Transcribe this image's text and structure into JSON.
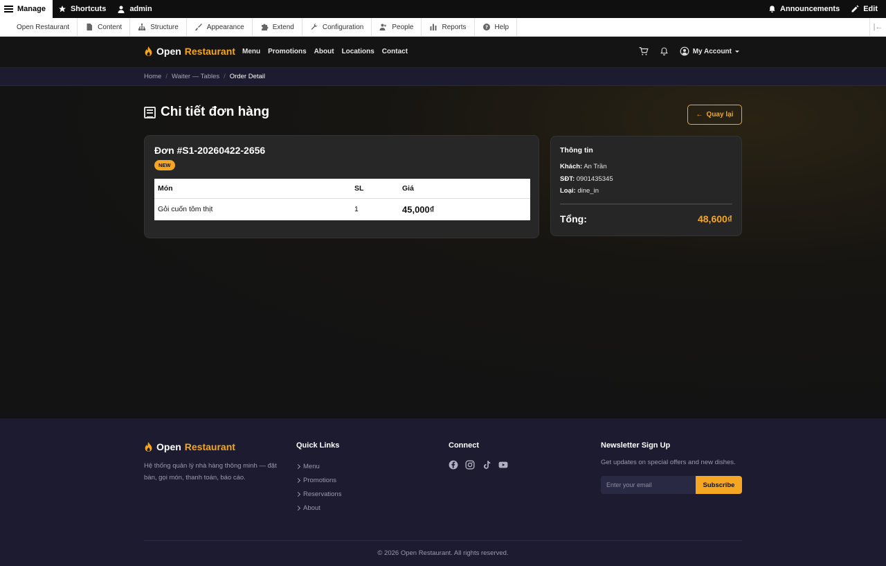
{
  "admin_toolbar": {
    "manage": "Manage",
    "shortcuts": "Shortcuts",
    "user": "admin",
    "announcements": "Announcements",
    "edit": "Edit"
  },
  "admin_tray": {
    "items": [
      "Open Restaurant",
      "Content",
      "Structure",
      "Appearance",
      "Extend",
      "Configuration",
      "People",
      "Reports",
      "Help"
    ]
  },
  "site_header": {
    "brand_first": "Open",
    "brand_second": "Restaurant",
    "nav": [
      "Menu",
      "Promotions",
      "About",
      "Locations",
      "Contact"
    ],
    "account": "My Account"
  },
  "breadcrumb": [
    "Home",
    "Waiter — Tables",
    "Order Detail"
  ],
  "page": {
    "title": "Chi tiết đơn hàng",
    "back_button": "Quay lại"
  },
  "order": {
    "title": "Đơn #S1-20260422-2656",
    "status": "NEW",
    "columns": [
      "Món",
      "SL",
      "Giá"
    ],
    "items": [
      {
        "name": "Gỏi cuốn tôm thịt",
        "qty": "1",
        "price": "45,000₫"
      }
    ]
  },
  "info": {
    "title": "Thông tin",
    "customer_label": "Khách:",
    "customer": "An Trần",
    "phone_label": "SĐT:",
    "phone": "0901435345",
    "type_label": "Loại:",
    "type": "dine_in",
    "total_label": "Tổng:",
    "total": "48,600₫"
  },
  "footer": {
    "brand_first": "Open",
    "brand_second": "Restaurant",
    "description": "Hệ thống quản lý nhà hàng thông minh — đặt bàn, gọi món, thanh toán, báo cáo.",
    "quick_links_title": "Quick Links",
    "quick_links": [
      "Menu",
      "Promotions",
      "Reservations",
      "About"
    ],
    "connect_title": "Connect",
    "newsletter_title": "Newsletter Sign Up",
    "newsletter_desc": "Get updates on special offers and new dishes.",
    "email_placeholder": "Enter your email",
    "subscribe": "Subscribe",
    "copyright": "© 2026 Open Restaurant. All rights reserved."
  },
  "colors": {
    "accent": "#f5a623",
    "footer_bg": "#1c1b30"
  }
}
